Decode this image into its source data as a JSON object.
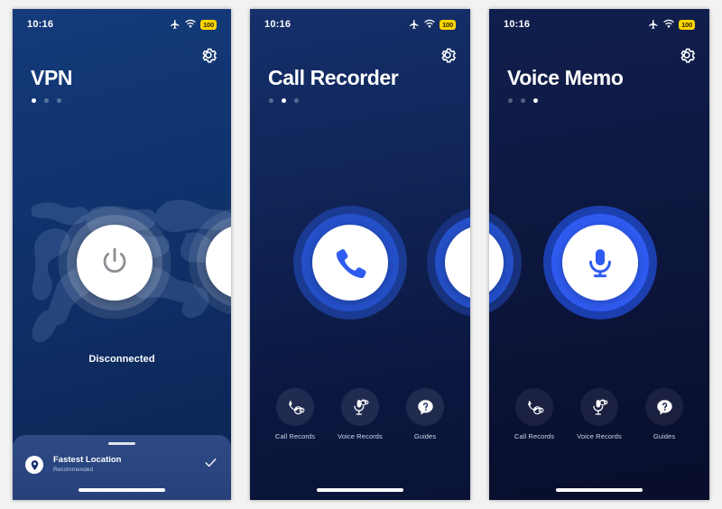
{
  "colors": {
    "accent_blue": "#2f5bf0",
    "call_blue": "#2450c9",
    "battery_yellow": "#ffd400",
    "sheet_blue": "#2d4a85",
    "white": "#ffffff"
  },
  "screens": [
    {
      "id": "vpn",
      "statusbar": {
        "time": "10:16",
        "airplane_icon": "airplane-mode-icon",
        "wifi_icon": "wifi-icon",
        "battery_level": "100"
      },
      "settings_icon": "gear-icon",
      "title": "VPN",
      "page_dots": {
        "count": 3,
        "active": 0
      },
      "main_button": {
        "icon": "power-icon",
        "label": ""
      },
      "state_label": "Disconnected",
      "sheet": {
        "pin_icon": "location-pin-icon",
        "title": "Fastest Location",
        "subtitle": "Recommended",
        "check_icon": "checkmark-icon"
      }
    },
    {
      "id": "call-recorder",
      "statusbar": {
        "time": "10:16",
        "airplane_icon": "airplane-mode-icon",
        "wifi_icon": "wifi-icon",
        "battery_level": "100"
      },
      "settings_icon": "gear-icon",
      "title": "Call Recorder",
      "page_dots": {
        "count": 3,
        "active": 1
      },
      "main_button": {
        "icon": "phone-icon",
        "label": ""
      },
      "shortcuts": [
        {
          "icon": "call-records-icon",
          "label": "Call Records"
        },
        {
          "icon": "voice-records-icon",
          "label": "Voice Records"
        },
        {
          "icon": "question-bubble-icon",
          "label": "Guides"
        }
      ]
    },
    {
      "id": "voice-memo",
      "statusbar": {
        "time": "10:16",
        "airplane_icon": "airplane-mode-icon",
        "wifi_icon": "wifi-icon",
        "battery_level": "100"
      },
      "settings_icon": "gear-icon",
      "title": "Voice Memo",
      "page_dots": {
        "count": 3,
        "active": 2
      },
      "main_button": {
        "icon": "microphone-icon",
        "label": ""
      },
      "shortcuts": [
        {
          "icon": "call-records-icon",
          "label": "Call Records"
        },
        {
          "icon": "voice-records-icon",
          "label": "Voice Records"
        },
        {
          "icon": "question-bubble-icon",
          "label": "Guides"
        }
      ]
    }
  ]
}
